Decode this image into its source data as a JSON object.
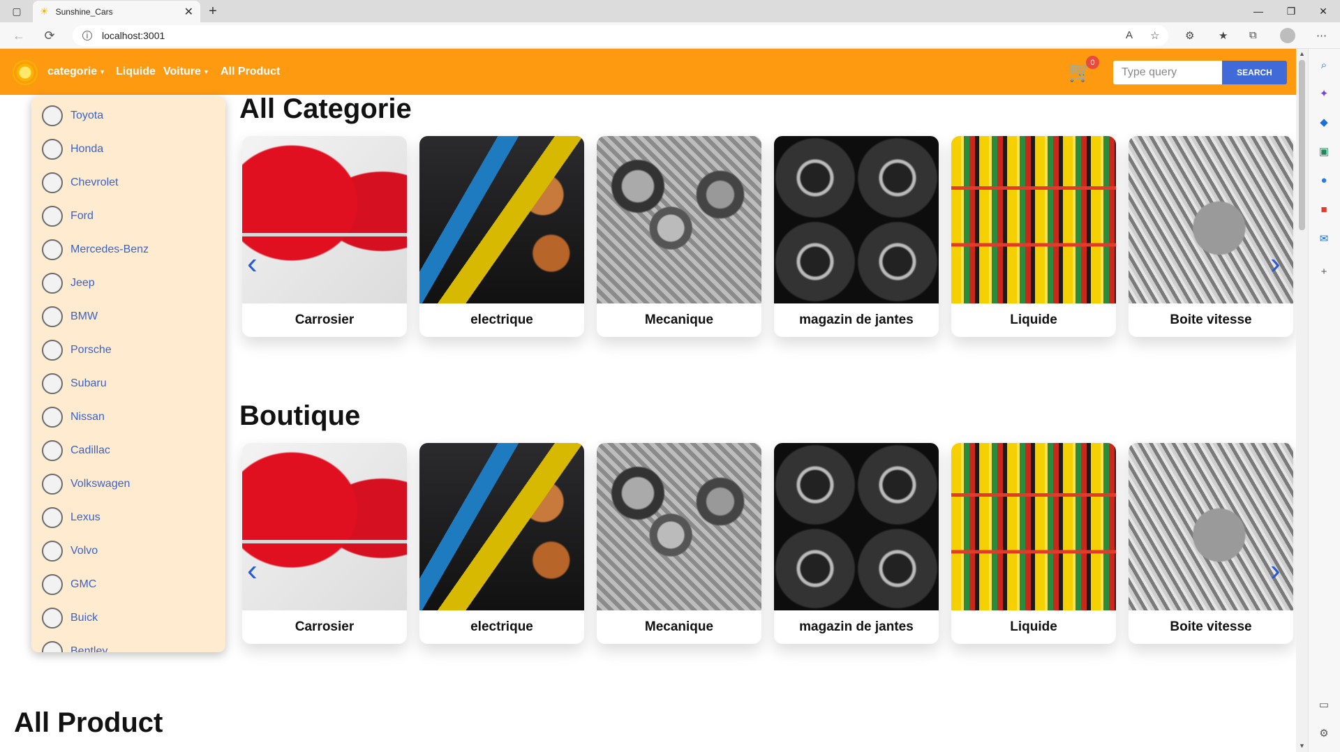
{
  "browser": {
    "tab_title": "Sunshine_Cars",
    "url": "localhost:3001",
    "icons": {
      "sidebar": "▢",
      "favicon": "☀",
      "close": "✕",
      "new_tab": "+",
      "minimize": "—",
      "restore": "❐",
      "window_close": "✕",
      "back": "←",
      "reload": "⟳",
      "info": "i",
      "read_aloud": "A",
      "favorite": "☆",
      "extensions": "⚙",
      "favorites": "★",
      "collections": "⧉",
      "more": "⋯"
    }
  },
  "navbar": {
    "links": [
      {
        "label": "categorie",
        "has_caret": true
      },
      {
        "label": "Liquide",
        "has_caret": false
      },
      {
        "label": "Voiture",
        "has_caret": true
      },
      {
        "label": "All Product",
        "has_caret": false
      }
    ],
    "caret": "▼",
    "cart_icon": "🛒",
    "cart_count": "0",
    "search_placeholder": "Type query",
    "search_button": "SEARCH",
    "accent": "#fd9a10"
  },
  "brands": [
    {
      "label": "Toyota",
      "icon": "toyota-logo-icon"
    },
    {
      "label": "Honda",
      "icon": "honda-logo-icon"
    },
    {
      "label": "Chevrolet",
      "icon": "chevrolet-logo-icon"
    },
    {
      "label": "Ford",
      "icon": "ford-logo-icon"
    },
    {
      "label": "Mercedes-Benz",
      "icon": "mercedes-logo-icon"
    },
    {
      "label": "Jeep",
      "icon": "jeep-logo-icon"
    },
    {
      "label": "BMW",
      "icon": "bmw-logo-icon"
    },
    {
      "label": "Porsche",
      "icon": "porsche-logo-icon"
    },
    {
      "label": "Subaru",
      "icon": "subaru-logo-icon"
    },
    {
      "label": "Nissan",
      "icon": "nissan-logo-icon"
    },
    {
      "label": "Cadillac",
      "icon": "cadillac-logo-icon"
    },
    {
      "label": "Volkswagen",
      "icon": "volkswagen-logo-icon"
    },
    {
      "label": "Lexus",
      "icon": "lexus-logo-icon"
    },
    {
      "label": "Volvo",
      "icon": "volvo-logo-icon"
    },
    {
      "label": "GMC",
      "icon": "gmc-logo-icon"
    },
    {
      "label": "Buick",
      "icon": "buick-logo-icon"
    },
    {
      "label": "Bentley",
      "icon": "bentley-logo-icon"
    }
  ],
  "sections": {
    "categorie_title": "All Categorie",
    "boutique_title": "Boutique",
    "product_title": "All Product"
  },
  "categories": [
    {
      "label": "Carrosier",
      "image": "car-body-parts-image"
    },
    {
      "label": "electrique",
      "image": "electric-cables-image"
    },
    {
      "label": "Mecanique",
      "image": "engine-image"
    },
    {
      "label": "magazin de jantes",
      "image": "wheel-rims-image"
    },
    {
      "label": "Liquide",
      "image": "motor-oil-shelves-image"
    },
    {
      "label": "Boite vitesse",
      "image": "gearbox-image"
    }
  ],
  "carousel": {
    "prev": "‹",
    "next": "›"
  }
}
